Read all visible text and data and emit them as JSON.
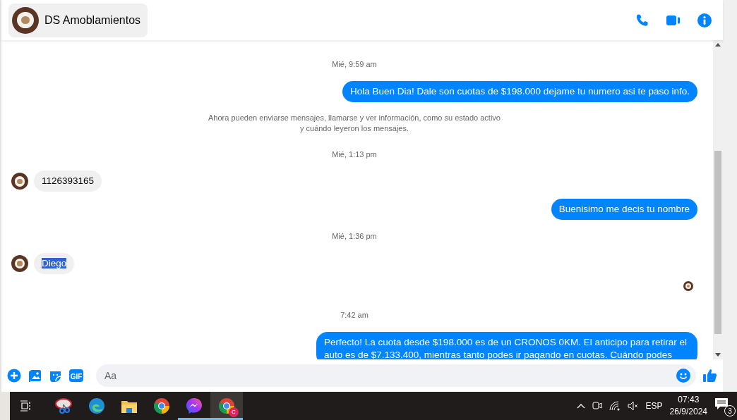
{
  "header": {
    "title": "DS Amoblamientos"
  },
  "messages": [
    {
      "kind": "timestamp",
      "text": "Mié, 9:59 am"
    },
    {
      "kind": "outgoing",
      "text": "Hola Buen Dia! Dale son cuotas de $198.000 dejame tu numero asi te paso info."
    },
    {
      "kind": "notice",
      "text": "Ahora pueden enviarse mensajes, llamarse y ver información, como su estado activo\ny cuándo leyeron los mensajes."
    },
    {
      "kind": "timestamp",
      "text": "Mié, 1:13 pm"
    },
    {
      "kind": "incoming",
      "text": "1126393165",
      "highlighted": false
    },
    {
      "kind": "outgoing",
      "text": "Buenisimo me decis tu nombre"
    },
    {
      "kind": "timestamp",
      "text": "Mié, 1:36 pm"
    },
    {
      "kind": "incoming",
      "text": "Diego",
      "highlighted": true
    },
    {
      "kind": "seen"
    },
    {
      "kind": "timestamp",
      "text": "7:42 am"
    },
    {
      "kind": "outgoing",
      "text": "Perfecto! La cuota desde $198.000 es de un CRONOS 0KM. El anticipo para retirar el auto es de $7.133.400, mientras tanto podes ir pagando en cuotas. Cuándo podes"
    }
  ],
  "composer": {
    "gif_label": "GIF",
    "placeholder": "Aa"
  },
  "taskbar": {
    "apps": [
      {
        "kind": "snip",
        "running": false,
        "active": false
      },
      {
        "kind": "edge",
        "running": false,
        "active": false
      },
      {
        "kind": "folder",
        "running": false,
        "active": false
      },
      {
        "kind": "chrome",
        "running": false,
        "active": false
      },
      {
        "kind": "messenger",
        "running": true,
        "active": false
      },
      {
        "kind": "chrome-profile",
        "running": true,
        "active": true,
        "badge": "C"
      }
    ],
    "language": "ESP",
    "time": "07:43",
    "date": "26/9/2024",
    "notifications": "3"
  }
}
